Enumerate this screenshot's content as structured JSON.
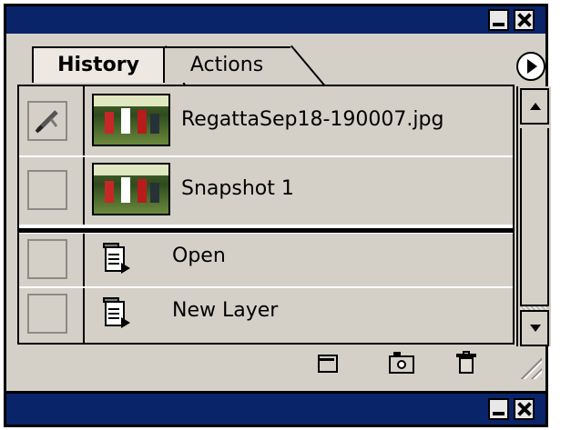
{
  "window": {
    "minimize_icon": "minimize-icon",
    "close_icon": "close-icon"
  },
  "tabs": [
    {
      "label": "History",
      "active": true
    },
    {
      "label": "Actions",
      "active": false
    }
  ],
  "panel_menu_icon": "play-circle-icon",
  "history": {
    "snapshots": [
      {
        "label": "RegattaSep18-190007.jpg",
        "source_brush": true
      },
      {
        "label": "Snapshot 1",
        "source_brush": false
      }
    ],
    "states": [
      {
        "label": "Open",
        "icon": "history-state-icon"
      },
      {
        "label": "New Layer",
        "icon": "history-state-icon"
      }
    ]
  },
  "footer": {
    "icons": [
      "new-document-from-state-icon",
      "create-snapshot-icon",
      "delete-state-icon"
    ]
  },
  "colors": {
    "titlebar": "#0a246a",
    "panel": "#d4d0c8"
  }
}
